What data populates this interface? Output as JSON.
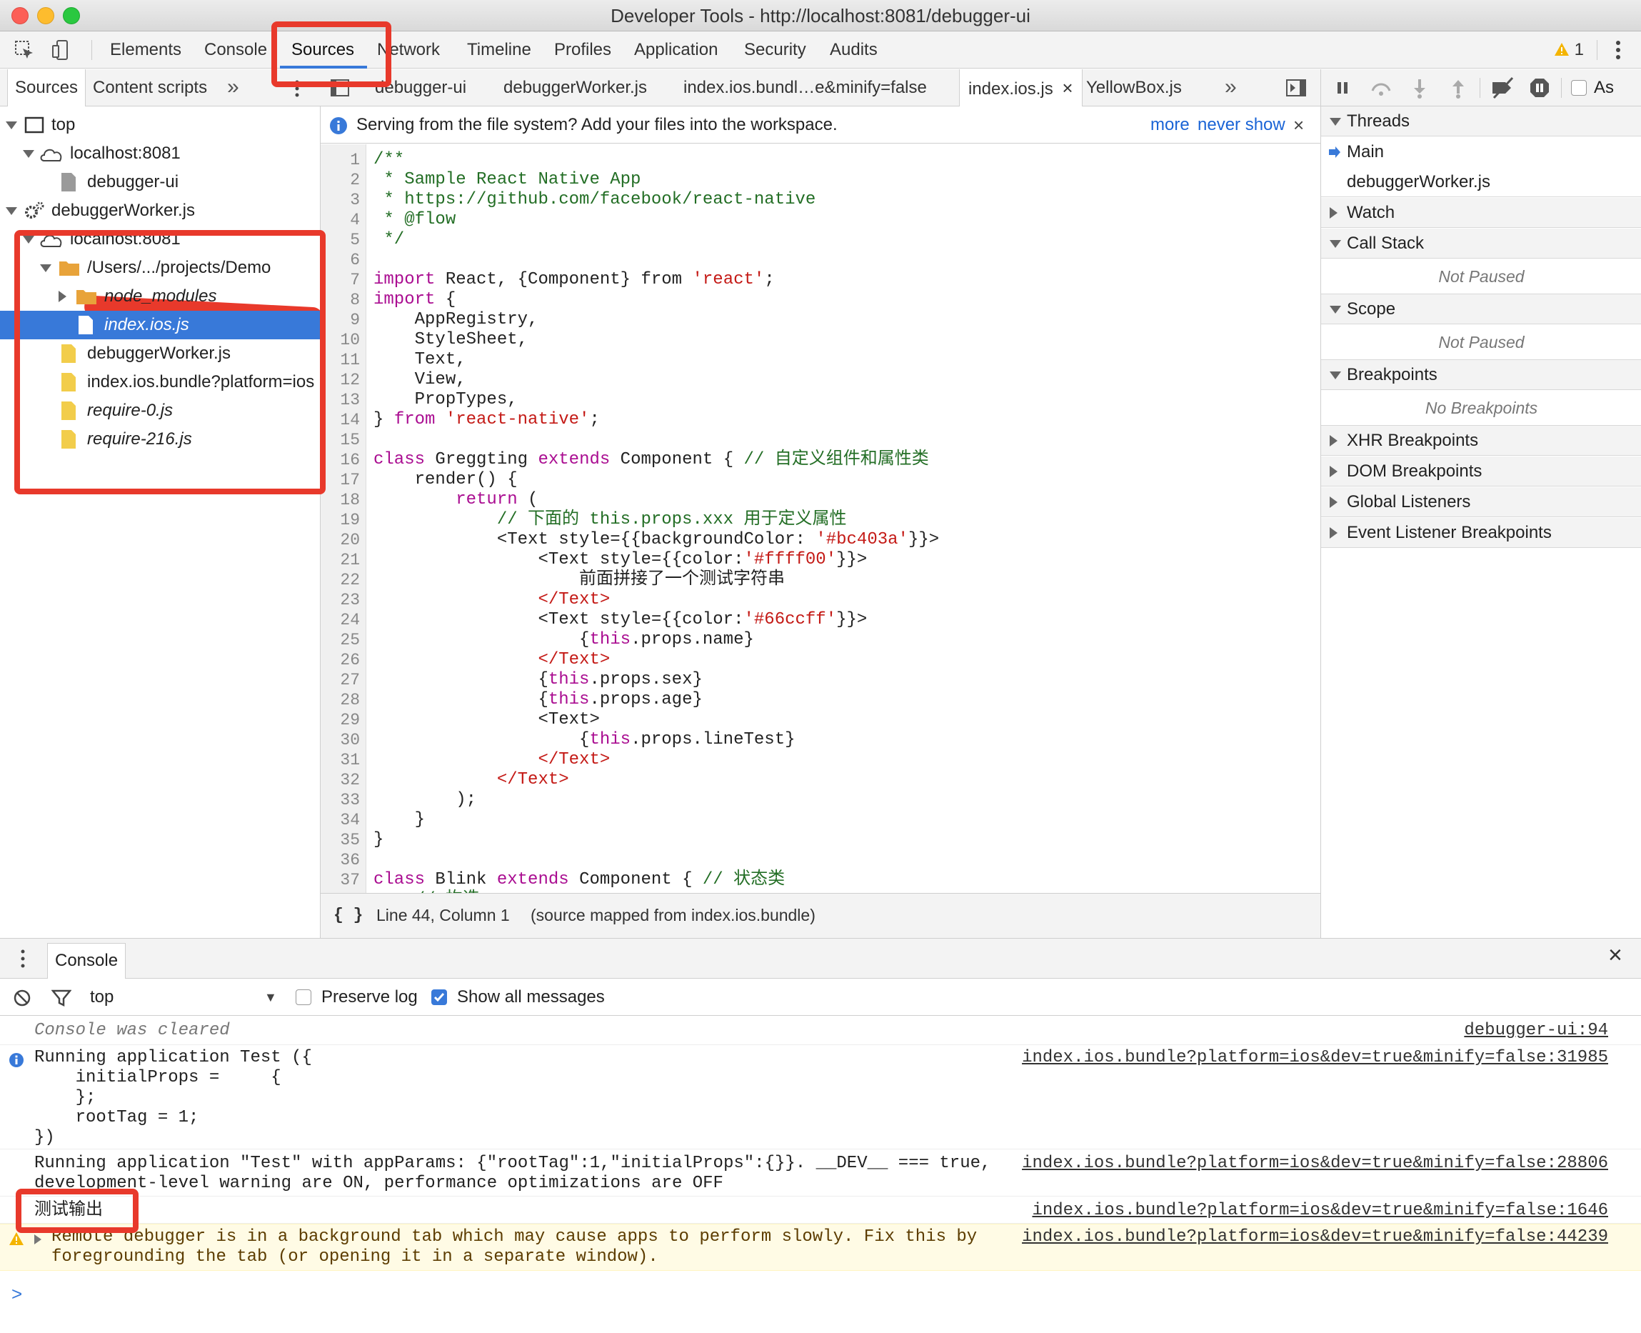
{
  "window": {
    "title": "Developer Tools - http://localhost:8081/debugger-ui"
  },
  "main_tabs": [
    "Elements",
    "Console",
    "Sources",
    "Network",
    "Timeline",
    "Profiles",
    "Application",
    "Security",
    "Audits"
  ],
  "active_main_tab": "Sources",
  "warning_count": "1",
  "navigator": {
    "tabs": [
      "Sources",
      "Content scripts"
    ],
    "tree": {
      "top": "top",
      "host1": "localhost:8081",
      "debugger_ui": "debugger-ui",
      "worker": "debuggerWorker.js",
      "host2": "localhost:8081",
      "project_folder": "/Users/.../projects/Demo",
      "node_modules": "node_modules",
      "index_ios": "index.ios.js",
      "worker_file": "debuggerWorker.js",
      "bundle": "index.ios.bundle?platform=ios",
      "require0": "require-0.js",
      "require216": "require-216.js"
    }
  },
  "editor": {
    "file_tabs": [
      "debugger-ui",
      "debuggerWorker.js",
      "index.ios.bundl…e&minify=false",
      "index.ios.js",
      "YellowBox.js"
    ],
    "active_file_tab": "index.ios.js",
    "infobar": {
      "message": "Serving from the file system? Add your files into the workspace.",
      "more": "more",
      "never_show": "never show"
    },
    "status": {
      "braces": "{ }",
      "position": "Line 44, Column 1",
      "mapping": "(source mapped from index.ios.bundle)"
    }
  },
  "code_lines": [
    [
      [
        "c",
        "/**"
      ]
    ],
    [
      [
        "c",
        " * Sample React Native App"
      ]
    ],
    [
      [
        "c",
        " * https://github.com/facebook/react-native"
      ]
    ],
    [
      [
        "c",
        " * @flow"
      ]
    ],
    [
      [
        "c",
        " */"
      ]
    ],
    [],
    [
      [
        "k",
        "import"
      ],
      [
        "",
        " React, {Component} "
      ],
      [
        "",
        "from "
      ],
      [
        "s",
        "'react'"
      ],
      [
        "",
        ";"
      ]
    ],
    [
      [
        "k",
        "import"
      ],
      [
        "",
        " {"
      ]
    ],
    [
      [
        "",
        "    AppRegistry,"
      ]
    ],
    [
      [
        "",
        "    StyleSheet,"
      ]
    ],
    [
      [
        "",
        "    Text,"
      ]
    ],
    [
      [
        "",
        "    View,"
      ]
    ],
    [
      [
        "",
        "    PropTypes,"
      ]
    ],
    [
      [
        "",
        "} "
      ],
      [
        "k",
        "from"
      ],
      [
        "",
        " "
      ],
      [
        "s",
        "'react-native'"
      ],
      [
        "",
        ";"
      ]
    ],
    [],
    [
      [
        "k",
        "class"
      ],
      [
        "",
        " Greggting "
      ],
      [
        "k",
        "extends"
      ],
      [
        "",
        " Component { "
      ],
      [
        "c",
        "// 自定义组件和属性类"
      ]
    ],
    [
      [
        "",
        "    render() {"
      ]
    ],
    [
      [
        "",
        "        "
      ],
      [
        "k",
        "return"
      ],
      [
        "",
        " ("
      ]
    ],
    [
      [
        "",
        "            "
      ],
      [
        "c",
        "// 下面的 this.props.xxx 用于定义属性"
      ]
    ],
    [
      [
        "",
        "            <Text style={{backgroundColor: "
      ],
      [
        "s",
        "'#bc403a'"
      ],
      [
        "",
        "}}>"
      ]
    ],
    [
      [
        "",
        "                <Text style={{color:"
      ],
      [
        "s",
        "'#ffff00'"
      ],
      [
        "",
        "}}>"
      ]
    ],
    [
      [
        "",
        "                    前面拼接了一个测试字符串"
      ]
    ],
    [
      [
        "",
        "                "
      ],
      [
        "tr",
        "</Text>"
      ]
    ],
    [
      [
        "",
        "                <Text style={{color:"
      ],
      [
        "s",
        "'#66ccff'"
      ],
      [
        "",
        "}}>"
      ]
    ],
    [
      [
        "",
        "                    {"
      ],
      [
        "k",
        "this"
      ],
      [
        "",
        ".props.name}"
      ]
    ],
    [
      [
        "",
        "                "
      ],
      [
        "tr",
        "</Text>"
      ]
    ],
    [
      [
        "",
        "                {"
      ],
      [
        "k",
        "this"
      ],
      [
        "",
        ".props.sex}"
      ]
    ],
    [
      [
        "",
        "                {"
      ],
      [
        "k",
        "this"
      ],
      [
        "",
        ".props.age}"
      ]
    ],
    [
      [
        "",
        "                <Text>"
      ]
    ],
    [
      [
        "",
        "                    {"
      ],
      [
        "k",
        "this"
      ],
      [
        "",
        ".props.lineTest}"
      ]
    ],
    [
      [
        "",
        "                "
      ],
      [
        "tr",
        "</Text>"
      ]
    ],
    [
      [
        "",
        "            "
      ],
      [
        "tr",
        "</Text>"
      ]
    ],
    [
      [
        "",
        "        );"
      ]
    ],
    [
      [
        "",
        "    }"
      ]
    ],
    [
      [
        "",
        "}"
      ]
    ],
    [],
    [
      [
        "k",
        "class"
      ],
      [
        "",
        " Blink "
      ],
      [
        "k",
        "extends"
      ],
      [
        "",
        " Component { "
      ],
      [
        "c",
        "// 状态类"
      ]
    ],
    [
      [
        "",
        "    "
      ],
      [
        "c",
        "// 构造"
      ]
    ]
  ],
  "sidebar": {
    "threads": "Threads",
    "thread_main": "Main",
    "thread_worker": "debuggerWorker.js",
    "watch": "Watch",
    "call_stack": "Call Stack",
    "not_paused_1": "Not Paused",
    "scope": "Scope",
    "not_paused_2": "Not Paused",
    "breakpoints": "Breakpoints",
    "no_breakpoints": "No Breakpoints",
    "xhr": "XHR Breakpoints",
    "dom": "DOM Breakpoints",
    "global": "Global Listeners",
    "event": "Event Listener Breakpoints",
    "async_label": "As"
  },
  "console": {
    "tab": "Console",
    "context": "top",
    "preserve_log": "Preserve log",
    "show_all": "Show all messages",
    "show_all_checked": true,
    "messages": [
      {
        "text": "Console was cleared",
        "src": "debugger-ui:94"
      },
      {
        "text": "Running application Test ({\n    initialProps =     {\n    };\n    rootTag = 1;\n})",
        "src": "index.ios.bundle?platform=ios&dev=true&minify=false:31985"
      },
      {
        "text": "Running application \"Test\" with appParams: {\"rootTag\":1,\"initialProps\":{}}. __DEV__ === true,\ndevelopment-level warning are ON, performance optimizations are OFF",
        "src": "index.ios.bundle?platform=ios&dev=true&minify=false:28806"
      },
      {
        "text": "测试输出",
        "src": "index.ios.bundle?platform=ios&dev=true&minify=false:1646"
      },
      {
        "text": "Remote debugger is in a background tab which may cause apps to perform slowly. Fix this by\nforegrounding the tab (or opening it in a separate window).",
        "src": "index.ios.bundle?platform=ios&dev=true&minify=false:44239"
      }
    ],
    "prompt": ">"
  },
  "colors": {
    "accent": "#3879d9",
    "annotation_red": "#e8392b",
    "keyword": "#aa0d91",
    "string": "#c41a16",
    "comment": "#236e25"
  }
}
